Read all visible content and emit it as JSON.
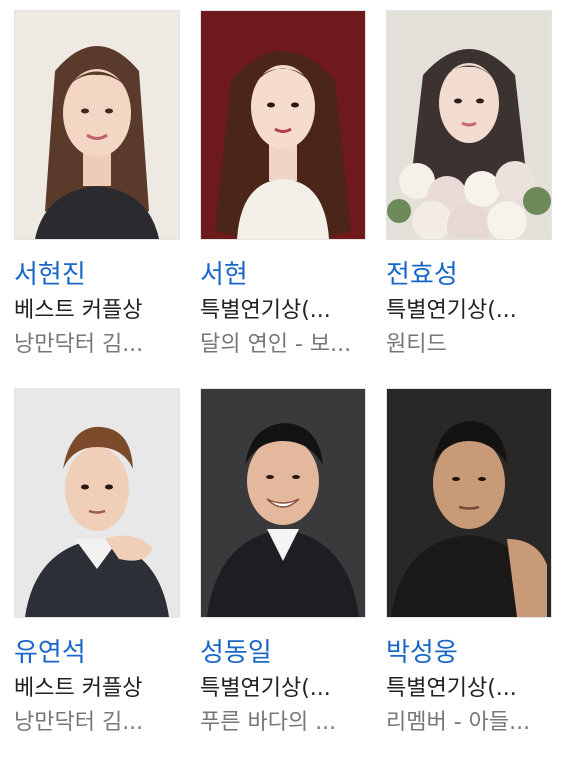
{
  "people": [
    {
      "name": "서현진",
      "award": "베스트 커플상",
      "work": "낭만닥터 김...",
      "photo": "portrait-photo-woman-long-brown-hair"
    },
    {
      "name": "서현",
      "award": "특별연기상(...",
      "work": "달의 연인 - 보...",
      "photo": "portrait-photo-woman-wavy-hair-red-background"
    },
    {
      "name": "전효성",
      "award": "특별연기상(...",
      "work": "원티드",
      "photo": "portrait-photo-woman-with-flowers"
    },
    {
      "name": "유연석",
      "award": "베스트 커플상",
      "work": "낭만닥터 김...",
      "photo": "portrait-photo-man-hand-on-chin"
    },
    {
      "name": "성동일",
      "award": "특별연기상(...",
      "work": "푸른 바다의 ...",
      "photo": "portrait-photo-man-smiling-dark-suit"
    },
    {
      "name": "박성웅",
      "award": "특별연기상(...",
      "work": "리멤버 - 아들...",
      "photo": "portrait-photo-man-dark-background"
    }
  ],
  "colors": {
    "name": "#1967c9",
    "award": "#222222",
    "work": "#777777"
  }
}
